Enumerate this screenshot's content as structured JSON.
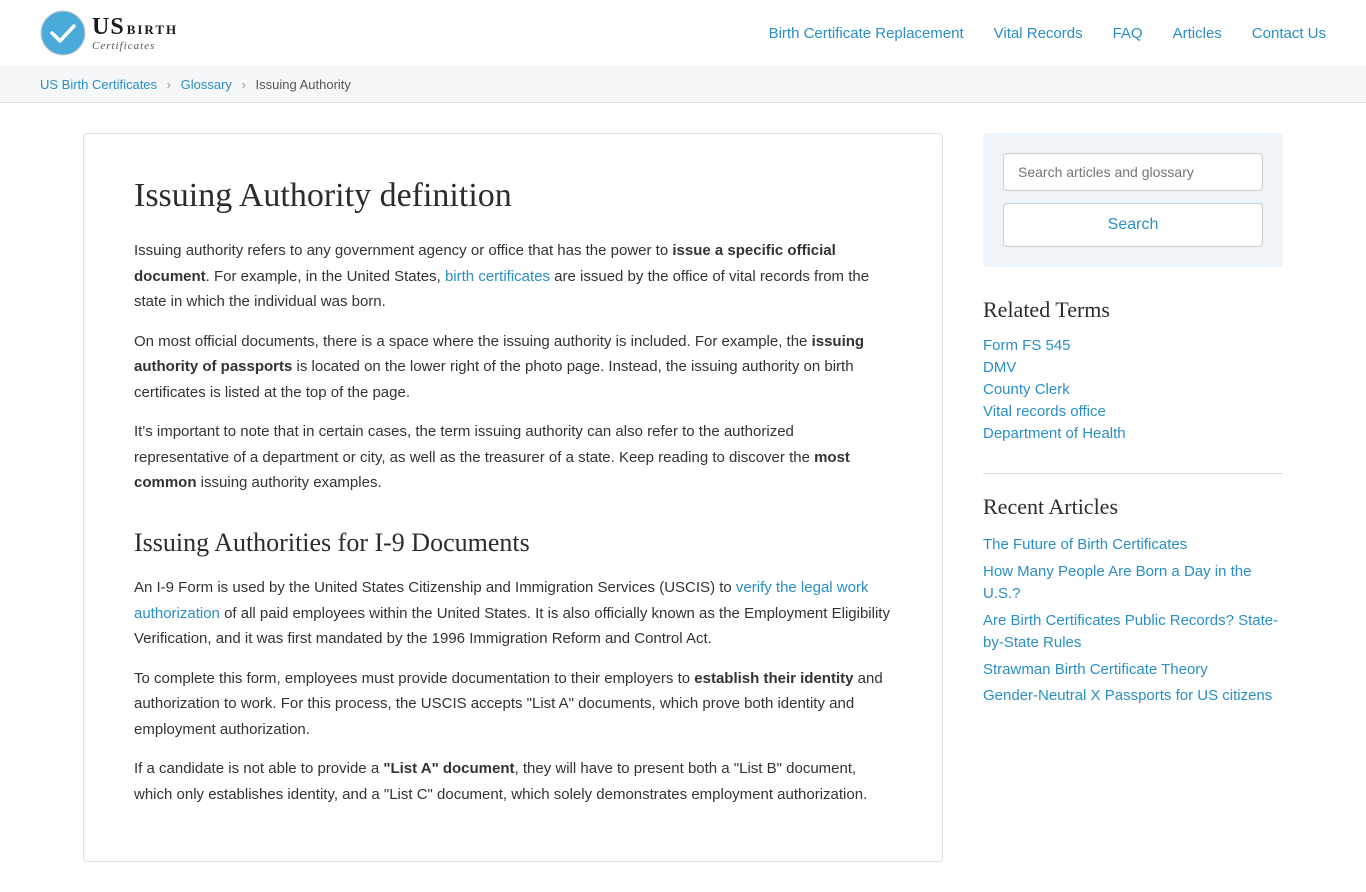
{
  "header": {
    "logo_us": "US",
    "logo_birth": "BIRTH",
    "logo_certificates": "Certificates",
    "nav": [
      {
        "label": "Birth Certificate Replacement",
        "href": "#"
      },
      {
        "label": "Vital Records",
        "href": "#"
      },
      {
        "label": "FAQ",
        "href": "#"
      },
      {
        "label": "Articles",
        "href": "#"
      },
      {
        "label": "Contact Us",
        "href": "#"
      }
    ]
  },
  "breadcrumb": {
    "items": [
      {
        "label": "US Birth Certificates",
        "href": "#"
      },
      {
        "label": "Glossary",
        "href": "#"
      },
      {
        "label": "Issuing Authority",
        "href": null
      }
    ]
  },
  "content": {
    "title": "Issuing Authority definition",
    "section2_title": "Issuing Authorities for I-9 Documents",
    "paragraphs": [
      {
        "id": "p1",
        "text_before": "Issuing authority refers to any government agency or office that has the power to ",
        "bold": "issue a specific official document",
        "text_after": ". For example, in the United States, ",
        "link_text": "birth certificates",
        "link_href": "#",
        "text_end": " are issued by the office of vital records from the state in which the individual was born."
      },
      {
        "id": "p2",
        "text_before": "On most official documents, there is a space where the issuing authority is included. For example, the ",
        "bold": "issuing authority of passports",
        "text_after": " is located on the lower right of the photo page. Instead, the issuing authority on birth certificates is listed at the top of the page."
      },
      {
        "id": "p3",
        "text_before": "It's important to note that in certain cases, the term issuing authority can also refer to the authorized representative of a department or city, as well as the treasurer of a state. Keep reading to discover the ",
        "bold": "most common",
        "text_after": " issuing authority examples."
      },
      {
        "id": "p4",
        "text_before": "An I-9 Form is used by the United States Citizenship and Immigration Services (USCIS) to ",
        "link_text": "verify the legal work authorization",
        "link_href": "#",
        "text_after": " of all paid employees within the United States. It is also officially known as the Employment Eligibility Verification, and it was first mandated by the 1996 Immigration Reform and Control Act."
      },
      {
        "id": "p5",
        "text_before": "To complete this form, employees must provide documentation to their employers to ",
        "bold": "establish their identity",
        "text_after": " and authorization to work. For this process, the USCIS accepts “List A” documents, which prove both identity and employment authorization."
      },
      {
        "id": "p6",
        "text_before": "If a candidate is not able to provide a ",
        "bold": "“List A” document",
        "text_after": ", they will have to present both a “List B” document, which only establishes identity, and a “List C” document, which solely demonstrates employment authorization."
      }
    ]
  },
  "sidebar": {
    "search": {
      "placeholder": "Search articles and glossary",
      "button_label": "Search"
    },
    "related_terms": {
      "title": "Related Terms",
      "items": [
        {
          "label": "Form FS 545",
          "href": "#"
        },
        {
          "label": "DMV",
          "href": "#"
        },
        {
          "label": "County Clerk",
          "href": "#"
        },
        {
          "label": "Vital records office",
          "href": "#"
        },
        {
          "label": "Department of Health",
          "href": "#"
        }
      ]
    },
    "recent_articles": {
      "title": "Recent Articles",
      "items": [
        {
          "label": "The Future of Birth Certificates",
          "href": "#"
        },
        {
          "label": "How Many People Are Born a Day in the U.S.?",
          "href": "#"
        },
        {
          "label": "Are Birth Certificates Public Records? State-by-State Rules",
          "href": "#"
        },
        {
          "label": "Strawman Birth Certificate Theory",
          "href": "#"
        },
        {
          "label": "Gender-Neutral X Passports for US citizens",
          "href": "#"
        }
      ]
    }
  }
}
